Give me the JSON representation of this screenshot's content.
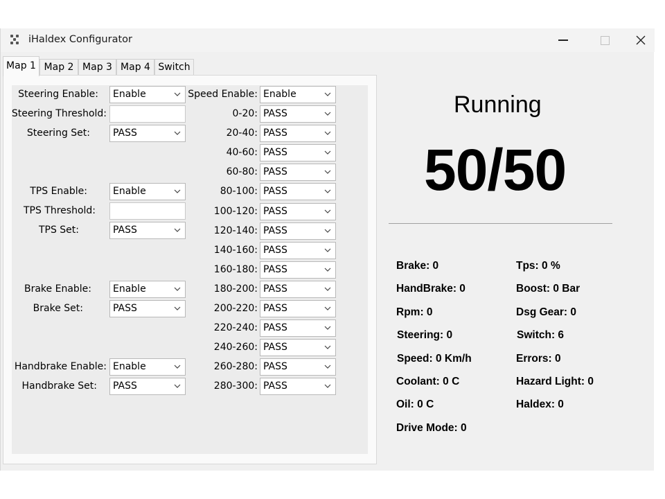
{
  "window": {
    "title": "iHaldex Configurator"
  },
  "tabs": [
    "Map 1",
    "Map 2",
    "Map 3",
    "Map 4",
    "Switch"
  ],
  "left": {
    "steering_enable_label": "Steering Enable:",
    "steering_enable_value": "Enable",
    "steering_threshold_label": "Steering Threshold:",
    "steering_threshold_value": "",
    "steering_set_label": "Steering Set:",
    "steering_set_value": "PASS",
    "tps_enable_label": "TPS Enable:",
    "tps_enable_value": "Enable",
    "tps_threshold_label": "TPS Threshold:",
    "tps_threshold_value": "",
    "tps_set_label": "TPS Set:",
    "tps_set_value": "PASS",
    "brake_enable_label": "Brake Enable:",
    "brake_enable_value": "Enable",
    "brake_set_label": "Brake Set:",
    "brake_set_value": "PASS",
    "handbrake_enable_label": "Handbrake Enable:",
    "handbrake_enable_value": "Enable",
    "handbrake_set_label": "Handbrake Set:",
    "handbrake_set_value": "PASS"
  },
  "speed": {
    "enable_label": "Speed Enable:",
    "enable_value": "Enable",
    "ranges": [
      {
        "label": "0-20:",
        "value": "PASS"
      },
      {
        "label": "20-40:",
        "value": "PASS"
      },
      {
        "label": "40-60:",
        "value": "PASS"
      },
      {
        "label": "60-80:",
        "value": "PASS"
      },
      {
        "label": "80-100:",
        "value": "PASS"
      },
      {
        "label": "100-120:",
        "value": "PASS"
      },
      {
        "label": "120-140:",
        "value": "PASS"
      },
      {
        "label": "140-160:",
        "value": "PASS"
      },
      {
        "label": "160-180:",
        "value": "PASS"
      },
      {
        "label": "180-200:",
        "value": "PASS"
      },
      {
        "label": "200-220:",
        "value": "PASS"
      },
      {
        "label": "220-240:",
        "value": "PASS"
      },
      {
        "label": "240-260:",
        "value": "PASS"
      },
      {
        "label": "260-280:",
        "value": "PASS"
      },
      {
        "label": "280-300:",
        "value": "PASS"
      }
    ]
  },
  "status": {
    "state": "Running",
    "ratio": "50/50"
  },
  "stats": {
    "brake": "Brake: 0",
    "handbrake": "HandBrake: 0",
    "rpm": "Rpm: 0",
    "steering": "Steering: 0",
    "speed": "Speed: 0 Km/h",
    "coolant": "Coolant: 0 C",
    "oil": "Oil: 0 C",
    "drive_mode": "Drive Mode: 0",
    "tps": "Tps: 0 %",
    "boost": "Boost: 0 Bar",
    "dsg_gear": "Dsg Gear: 0",
    "switch": "Switch: 6",
    "errors": "Errors: 0",
    "hazard_light": "Hazard Light: 0",
    "haldex": "Haldex: 0"
  }
}
